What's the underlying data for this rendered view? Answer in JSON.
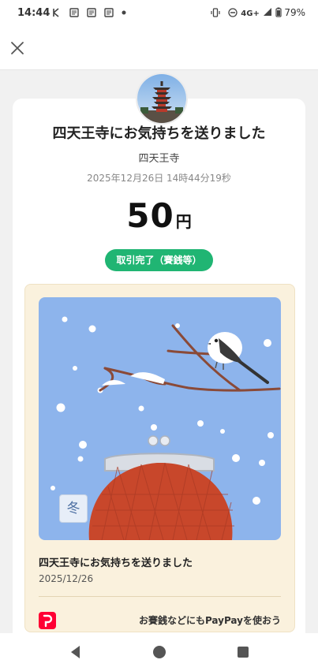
{
  "status_bar": {
    "time": "14:44",
    "network": "4G+",
    "battery": "79%"
  },
  "header": {
    "close_icon": "close-icon"
  },
  "receipt": {
    "title": "四天王寺にお気持ちを送りました",
    "store_name": "四天王寺",
    "datetime": "2025年12月26日 14時44分19秒",
    "amount": "50",
    "currency": "円",
    "status": "取引完了（賽銭等）",
    "status_color": "#20b573"
  },
  "gift_card": {
    "season_label": "冬",
    "title": "四天王寺にお気持ちを送りました",
    "date": "2025/12/26",
    "promo_text": "お賽銭などにもPayPayを使おう",
    "promo_logo": "paypay-logo"
  },
  "nav": {
    "back_icon": "back-triangle-icon",
    "home_icon": "home-circle-icon",
    "recents_icon": "recents-square-icon"
  }
}
